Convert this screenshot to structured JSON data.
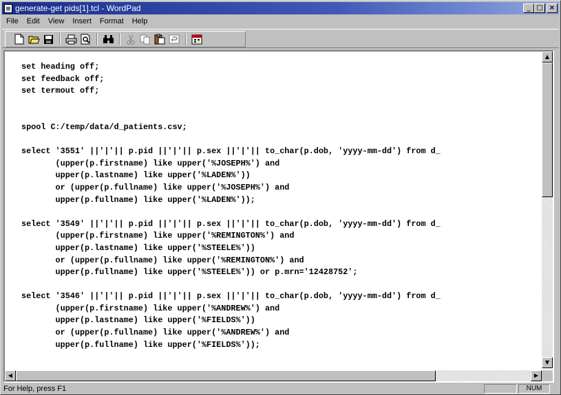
{
  "window": {
    "title": "generate-get pids[1].tcl - WordPad",
    "minimize": "_",
    "maximize": "□",
    "close": "×"
  },
  "menu": [
    {
      "label": "File"
    },
    {
      "label": "Edit"
    },
    {
      "label": "View"
    },
    {
      "label": "Insert"
    },
    {
      "label": "Format"
    },
    {
      "label": "Help"
    }
  ],
  "toolbar": {
    "new_icon": "new-document-icon",
    "open_icon": "open-folder-icon",
    "save_icon": "save-disk-icon",
    "print_icon": "print-icon",
    "preview_icon": "print-preview-icon",
    "find_icon": "binoculars-icon",
    "cut_icon": "scissors-icon",
    "copy_icon": "copy-icon",
    "paste_icon": "paste-icon",
    "undo_icon": "undo-icon",
    "datetime_icon": "date-time-icon"
  },
  "document": {
    "text": "set heading off;\nset feedback off;\nset termout off;\n\n\nspool C:/temp/data/d_patients.csv;\n\nselect '3551' ||'|'|| p.pid ||'|'|| p.sex ||'|'|| to_char(p.dob, 'yyyy-mm-dd') from d_\n       (upper(p.firstname) like upper('%JOSEPH%') and\n       upper(p.lastname) like upper('%LADEN%'))\n       or (upper(p.fullname) like upper('%JOSEPH%') and\n       upper(p.fullname) like upper('%LADEN%'));\n\nselect '3549' ||'|'|| p.pid ||'|'|| p.sex ||'|'|| to_char(p.dob, 'yyyy-mm-dd') from d_\n       (upper(p.firstname) like upper('%REMINGTON%') and\n       upper(p.lastname) like upper('%STEELE%'))\n       or (upper(p.fullname) like upper('%REMINGTON%') and\n       upper(p.fullname) like upper('%STEELE%')) or p.mrn='12428752';\n\nselect '3546' ||'|'|| p.pid ||'|'|| p.sex ||'|'|| to_char(p.dob, 'yyyy-mm-dd') from d_\n       (upper(p.firstname) like upper('%ANDREW%') and\n       upper(p.lastname) like upper('%FIELDS%'))\n       or (upper(p.fullname) like upper('%ANDREW%') and\n       upper(p.fullname) like upper('%FIELDS%'));"
  },
  "status": {
    "help_text": "For Help, press F1",
    "num_indicator": "NUM"
  }
}
